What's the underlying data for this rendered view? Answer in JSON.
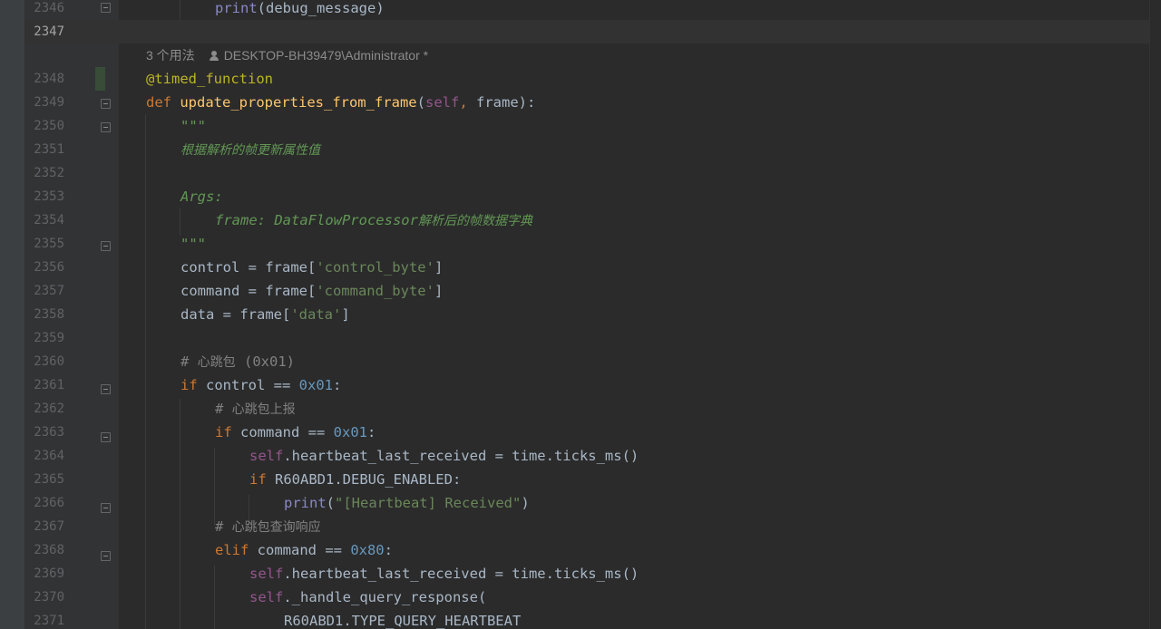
{
  "editor": {
    "inlay_hint": {
      "usages": "3 个用法",
      "author": "DESKTOP-BH39479\\Administrator *"
    },
    "line_numbers": [
      "2346",
      "2347",
      "",
      "2348",
      "2349",
      "2350",
      "2351",
      "2352",
      "2353",
      "2354",
      "2355",
      "2356",
      "2357",
      "2358",
      "2359",
      "2360",
      "2361",
      "2362",
      "2363",
      "2364",
      "2365",
      "2366",
      "2367",
      "2368",
      "2369",
      "2370",
      "2371"
    ],
    "current_line": "2347",
    "tokens": {
      "print": "print",
      "debug_args": "(debug_message)",
      "decorator": "@timed_function",
      "def": "def",
      "fn_name": "update_properties_from_frame",
      "paren_open": "(",
      "self": "self",
      "comma": ",",
      "frame_param": " frame",
      "sig_end": "):",
      "doc_quotes": "\"\"\"",
      "doc_desc": "根据解析的帧更新属性值",
      "doc_args": "Args:",
      "doc_frame_label": "frame: DataFlowProcessor",
      "doc_frame_desc": "解析后的帧数据字典",
      "control_lhs": "control = frame[",
      "control_key": "'control_byte'",
      "close_bracket": "]",
      "command_lhs": "command = frame[",
      "command_key": "'command_byte'",
      "data_lhs": "data = frame[",
      "data_key": "'data'",
      "cmt_hash": "# ",
      "cmt_heartbeat": "心跳包",
      "cmt_heartbeat_code": " (0x01)",
      "if": "if",
      "elif": "elif",
      "control_eq": " control == ",
      "command_eq": " command == ",
      "hex_01": "0x01",
      "hex_80": "0x80",
      "colon": ":",
      "cmt_report": "心跳包上报",
      "hb_assign": ".heartbeat_last_received = time.ticks_ms()",
      "debug_check": " R60ABD1.DEBUG_ENABLED:",
      "paren_close": ")",
      "hb_received_str": "\"[Heartbeat] Received\"",
      "cmt_query": "心跳包查询响应",
      "handle_query": "._handle_query_response(",
      "type_const": "R60ABD1.TYPE_QUERY_HEARTBEAT"
    }
  }
}
